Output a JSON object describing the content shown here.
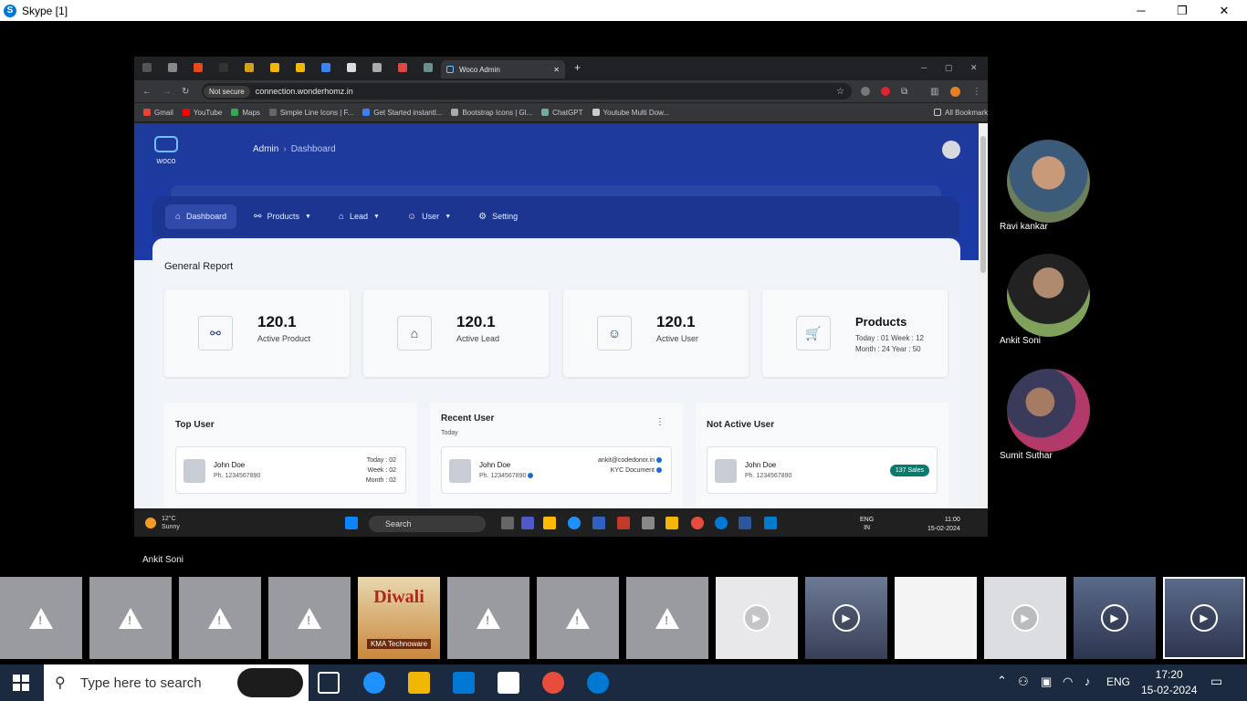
{
  "skype": {
    "title": "Skype [1]",
    "minimize": "─",
    "restore": "❐",
    "close": "✕"
  },
  "browser": {
    "active_tab": "Woco Admin",
    "not_secure": "Not secure",
    "url": "connection.wonderhomz.in",
    "bookmarks": [
      "Gmail",
      "YouTube",
      "Maps",
      "Simple Line Icons | F...",
      "Get Started instantl...",
      "Bootstrap Icons | Gl...",
      "ChatGPT",
      "Youtube Multi Dow..."
    ],
    "all_bookmarks": "All Bookmarks"
  },
  "woco": {
    "logo_text": "woco",
    "breadcrumb": {
      "root": "Admin",
      "current": "Dashboard"
    },
    "nav": [
      "Dashboard",
      "Products",
      "Lead",
      "User",
      "Setting"
    ],
    "general_report": "General Report",
    "stats": [
      {
        "value": "120.1",
        "label": "Active Product"
      },
      {
        "value": "120.1",
        "label": "Active Lead"
      },
      {
        "value": "120.1",
        "label": "Active User"
      }
    ],
    "products": {
      "title": "Products",
      "line1": "Today : 01   Week : 12",
      "line2": "Month : 24   Year : 50"
    },
    "top_user": {
      "title": "Top User",
      "name": "John Doe",
      "phone": "Ph. 1234567890",
      "today": "Today : 02",
      "week": "Week : 02",
      "month": "Month : 02"
    },
    "recent_user": {
      "title": "Recent User",
      "subtitle": "Today",
      "name": "John Doe",
      "phone": "Ph. 1234567890",
      "email": "ankit@codedonor.in",
      "kyc": "KYC Document"
    },
    "not_active_user": {
      "title": "Not Active User",
      "name": "John Doe",
      "phone": "Ph. 1234567890",
      "badge": "137 Sales"
    }
  },
  "inner_taskbar": {
    "temp": "12°C",
    "weather": "Sunny",
    "search": "Search",
    "lang1": "ENG",
    "lang2": "IN",
    "time": "11:00",
    "date": "15-02-2024"
  },
  "participants": [
    "Ravi kankar",
    "Ankit Soni",
    "Sumit Suthar"
  ],
  "speaker": "Ankit Soni",
  "thumbnails": {
    "diwali_title": "Diwali",
    "diwali_brand": "KMA Technoware"
  },
  "taskbar": {
    "search_placeholder": "Type here to search",
    "lang": "ENG",
    "time": "17:20",
    "date": "15-02-2024"
  }
}
